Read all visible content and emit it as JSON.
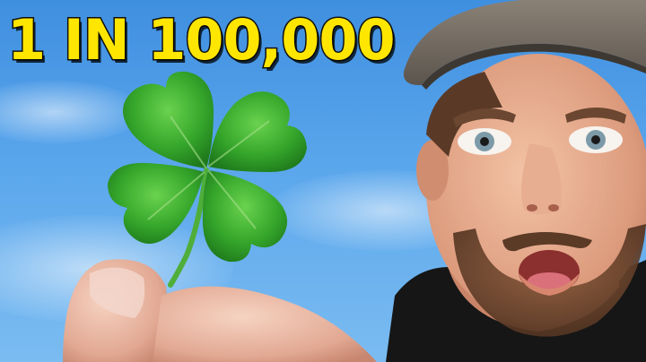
{
  "headline": {
    "text": "1 IN 100,000",
    "color": "#ffe600"
  },
  "scene": {
    "sky_color": "#4f9de6",
    "clover_color": "#34a82a"
  }
}
